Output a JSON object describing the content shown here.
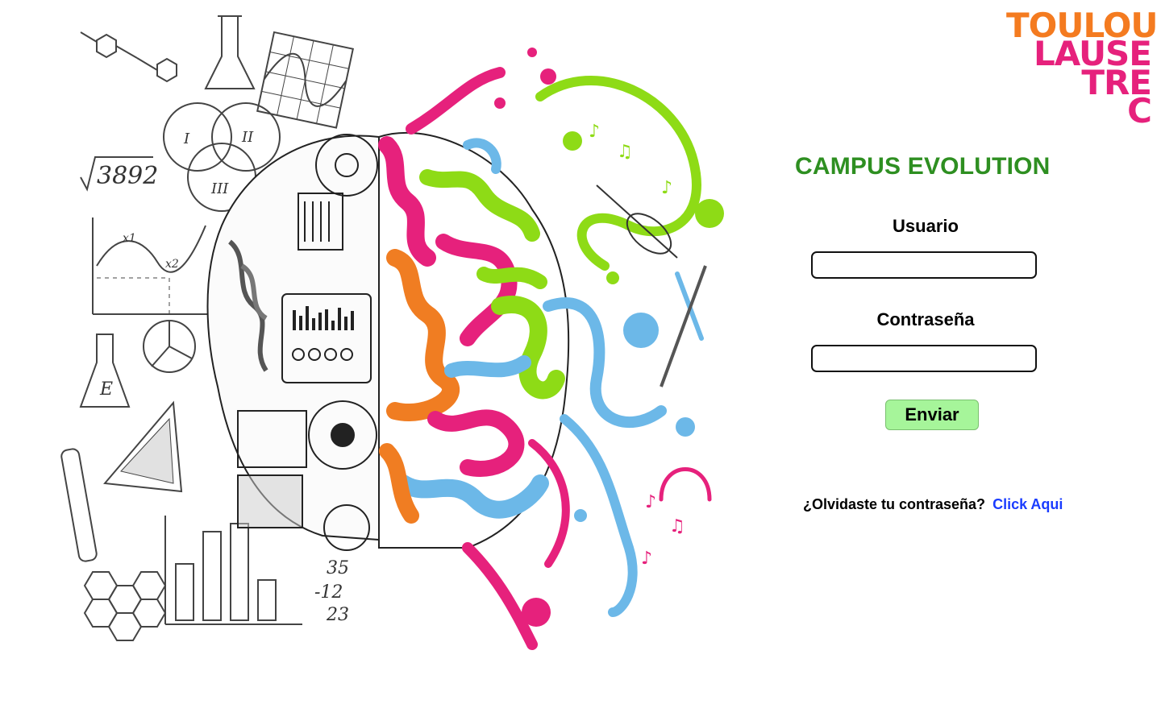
{
  "logo": {
    "line1": "TOULOU",
    "line2": "LAUSE",
    "line3": "TRE",
    "line4": "C",
    "colors": {
      "orange": "#f47b20",
      "magenta": "#e6217c"
    }
  },
  "login": {
    "title": "CAMPUS EVOLUTION",
    "title_color": "#2e8f21",
    "username_label": "Usuario",
    "username_value": "",
    "password_label": "Contraseña",
    "password_value": "",
    "submit_label": "Enviar",
    "submit_color": "#a6f59a",
    "forgot_text": "¿Olvidaste tu contraseña?",
    "forgot_link": "Click Aqui",
    "link_color": "#1a3cff"
  },
  "illustration": {
    "formula_text": "3892",
    "numbers": [
      "35",
      "-12",
      "23"
    ],
    "venn_labels": [
      "I",
      "II",
      "III"
    ],
    "graph_labels": [
      "x1",
      "x2"
    ],
    "flask_letter": "E"
  }
}
